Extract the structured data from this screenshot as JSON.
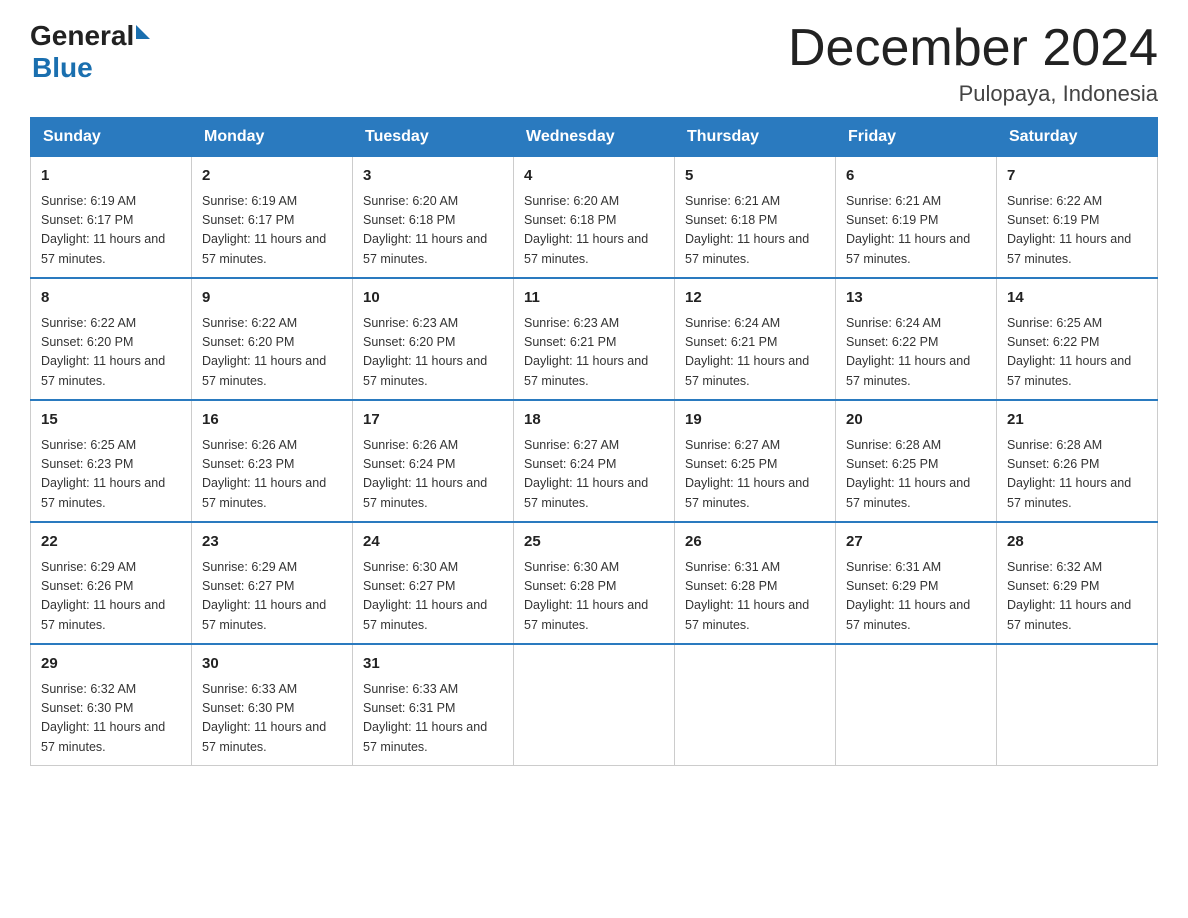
{
  "logo": {
    "general": "General",
    "blue": "Blue"
  },
  "title": "December 2024",
  "subtitle": "Pulopaya, Indonesia",
  "days_of_week": [
    "Sunday",
    "Monday",
    "Tuesday",
    "Wednesday",
    "Thursday",
    "Friday",
    "Saturday"
  ],
  "weeks": [
    [
      {
        "day": "1",
        "sunrise": "Sunrise: 6:19 AM",
        "sunset": "Sunset: 6:17 PM",
        "daylight": "Daylight: 11 hours and 57 minutes."
      },
      {
        "day": "2",
        "sunrise": "Sunrise: 6:19 AM",
        "sunset": "Sunset: 6:17 PM",
        "daylight": "Daylight: 11 hours and 57 minutes."
      },
      {
        "day": "3",
        "sunrise": "Sunrise: 6:20 AM",
        "sunset": "Sunset: 6:18 PM",
        "daylight": "Daylight: 11 hours and 57 minutes."
      },
      {
        "day": "4",
        "sunrise": "Sunrise: 6:20 AM",
        "sunset": "Sunset: 6:18 PM",
        "daylight": "Daylight: 11 hours and 57 minutes."
      },
      {
        "day": "5",
        "sunrise": "Sunrise: 6:21 AM",
        "sunset": "Sunset: 6:18 PM",
        "daylight": "Daylight: 11 hours and 57 minutes."
      },
      {
        "day": "6",
        "sunrise": "Sunrise: 6:21 AM",
        "sunset": "Sunset: 6:19 PM",
        "daylight": "Daylight: 11 hours and 57 minutes."
      },
      {
        "day": "7",
        "sunrise": "Sunrise: 6:22 AM",
        "sunset": "Sunset: 6:19 PM",
        "daylight": "Daylight: 11 hours and 57 minutes."
      }
    ],
    [
      {
        "day": "8",
        "sunrise": "Sunrise: 6:22 AM",
        "sunset": "Sunset: 6:20 PM",
        "daylight": "Daylight: 11 hours and 57 minutes."
      },
      {
        "day": "9",
        "sunrise": "Sunrise: 6:22 AM",
        "sunset": "Sunset: 6:20 PM",
        "daylight": "Daylight: 11 hours and 57 minutes."
      },
      {
        "day": "10",
        "sunrise": "Sunrise: 6:23 AM",
        "sunset": "Sunset: 6:20 PM",
        "daylight": "Daylight: 11 hours and 57 minutes."
      },
      {
        "day": "11",
        "sunrise": "Sunrise: 6:23 AM",
        "sunset": "Sunset: 6:21 PM",
        "daylight": "Daylight: 11 hours and 57 minutes."
      },
      {
        "day": "12",
        "sunrise": "Sunrise: 6:24 AM",
        "sunset": "Sunset: 6:21 PM",
        "daylight": "Daylight: 11 hours and 57 minutes."
      },
      {
        "day": "13",
        "sunrise": "Sunrise: 6:24 AM",
        "sunset": "Sunset: 6:22 PM",
        "daylight": "Daylight: 11 hours and 57 minutes."
      },
      {
        "day": "14",
        "sunrise": "Sunrise: 6:25 AM",
        "sunset": "Sunset: 6:22 PM",
        "daylight": "Daylight: 11 hours and 57 minutes."
      }
    ],
    [
      {
        "day": "15",
        "sunrise": "Sunrise: 6:25 AM",
        "sunset": "Sunset: 6:23 PM",
        "daylight": "Daylight: 11 hours and 57 minutes."
      },
      {
        "day": "16",
        "sunrise": "Sunrise: 6:26 AM",
        "sunset": "Sunset: 6:23 PM",
        "daylight": "Daylight: 11 hours and 57 minutes."
      },
      {
        "day": "17",
        "sunrise": "Sunrise: 6:26 AM",
        "sunset": "Sunset: 6:24 PM",
        "daylight": "Daylight: 11 hours and 57 minutes."
      },
      {
        "day": "18",
        "sunrise": "Sunrise: 6:27 AM",
        "sunset": "Sunset: 6:24 PM",
        "daylight": "Daylight: 11 hours and 57 minutes."
      },
      {
        "day": "19",
        "sunrise": "Sunrise: 6:27 AM",
        "sunset": "Sunset: 6:25 PM",
        "daylight": "Daylight: 11 hours and 57 minutes."
      },
      {
        "day": "20",
        "sunrise": "Sunrise: 6:28 AM",
        "sunset": "Sunset: 6:25 PM",
        "daylight": "Daylight: 11 hours and 57 minutes."
      },
      {
        "day": "21",
        "sunrise": "Sunrise: 6:28 AM",
        "sunset": "Sunset: 6:26 PM",
        "daylight": "Daylight: 11 hours and 57 minutes."
      }
    ],
    [
      {
        "day": "22",
        "sunrise": "Sunrise: 6:29 AM",
        "sunset": "Sunset: 6:26 PM",
        "daylight": "Daylight: 11 hours and 57 minutes."
      },
      {
        "day": "23",
        "sunrise": "Sunrise: 6:29 AM",
        "sunset": "Sunset: 6:27 PM",
        "daylight": "Daylight: 11 hours and 57 minutes."
      },
      {
        "day": "24",
        "sunrise": "Sunrise: 6:30 AM",
        "sunset": "Sunset: 6:27 PM",
        "daylight": "Daylight: 11 hours and 57 minutes."
      },
      {
        "day": "25",
        "sunrise": "Sunrise: 6:30 AM",
        "sunset": "Sunset: 6:28 PM",
        "daylight": "Daylight: 11 hours and 57 minutes."
      },
      {
        "day": "26",
        "sunrise": "Sunrise: 6:31 AM",
        "sunset": "Sunset: 6:28 PM",
        "daylight": "Daylight: 11 hours and 57 minutes."
      },
      {
        "day": "27",
        "sunrise": "Sunrise: 6:31 AM",
        "sunset": "Sunset: 6:29 PM",
        "daylight": "Daylight: 11 hours and 57 minutes."
      },
      {
        "day": "28",
        "sunrise": "Sunrise: 6:32 AM",
        "sunset": "Sunset: 6:29 PM",
        "daylight": "Daylight: 11 hours and 57 minutes."
      }
    ],
    [
      {
        "day": "29",
        "sunrise": "Sunrise: 6:32 AM",
        "sunset": "Sunset: 6:30 PM",
        "daylight": "Daylight: 11 hours and 57 minutes."
      },
      {
        "day": "30",
        "sunrise": "Sunrise: 6:33 AM",
        "sunset": "Sunset: 6:30 PM",
        "daylight": "Daylight: 11 hours and 57 minutes."
      },
      {
        "day": "31",
        "sunrise": "Sunrise: 6:33 AM",
        "sunset": "Sunset: 6:31 PM",
        "daylight": "Daylight: 11 hours and 57 minutes."
      },
      null,
      null,
      null,
      null
    ]
  ]
}
